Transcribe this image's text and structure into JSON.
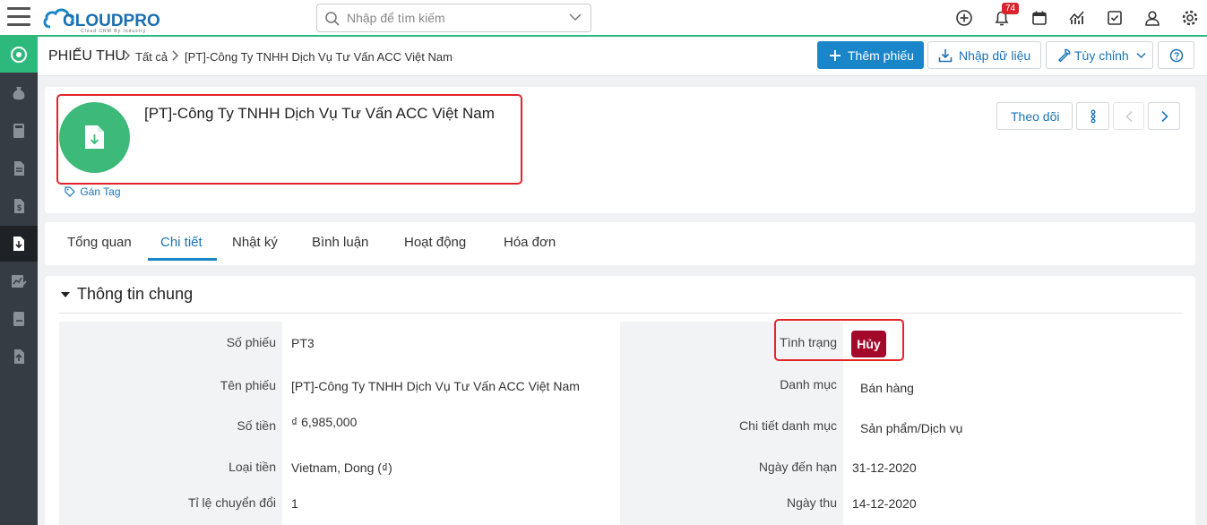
{
  "app": {
    "logo_text": "CLOUDPRO",
    "logo_sub": "Cloud CRM By Industry",
    "brand_color": "#2eb97c",
    "accent_color": "#1a86c9"
  },
  "search": {
    "placeholder": "Nhập để tìm kiếm"
  },
  "notifications": {
    "count": "74"
  },
  "breadcrumb": {
    "module": "PHIẾU THU",
    "all": "Tất cả",
    "current": "[PT]-Công Ty TNHH Dịch Vụ Tư Vấn ACC Việt Nam"
  },
  "toolbar": {
    "add_label": "Thêm phiếu",
    "import_label": "Nhập dữ liệu",
    "customize_label": "Tùy chỉnh"
  },
  "record": {
    "title": "[PT]-Công Ty TNHH Dịch Vụ Tư Vấn ACC Việt Nam",
    "tag_label": "Gán Tag",
    "follow_label": "Theo dõi"
  },
  "tabs": [
    {
      "label": "Tổng quan"
    },
    {
      "label": "Chi tiết"
    },
    {
      "label": "Nhật ký"
    },
    {
      "label": "Bình luận"
    },
    {
      "label": "Hoạt động"
    },
    {
      "label": "Hóa đơn"
    }
  ],
  "section": {
    "title": "Thông tin chung",
    "left_fields": [
      {
        "label": "Số phiếu",
        "value": "PT3"
      },
      {
        "label": "Tên phiếu",
        "value": "[PT]-Công Ty TNHH Dịch Vụ Tư Vấn ACC Việt Nam"
      },
      {
        "label": "Số tiền",
        "value": "₫ 6,985,000"
      },
      {
        "label": "Loại tiền",
        "value": "Vietnam, Dong (₫)"
      },
      {
        "label": "Tỉ lệ chuyển đổi",
        "value": "1"
      }
    ],
    "right_fields": [
      {
        "label": "Tình trạng",
        "value": "Hủy"
      },
      {
        "label": "Danh mục",
        "value": "Bán hàng"
      },
      {
        "label": "Chi tiết danh mục",
        "value": "Sản phẩm/Dịch vụ"
      },
      {
        "label": "Ngày đến hạn",
        "value": "31-12-2020"
      },
      {
        "label": "Ngày thu",
        "value": "14-12-2020"
      }
    ],
    "status_color": "#a3092a"
  }
}
